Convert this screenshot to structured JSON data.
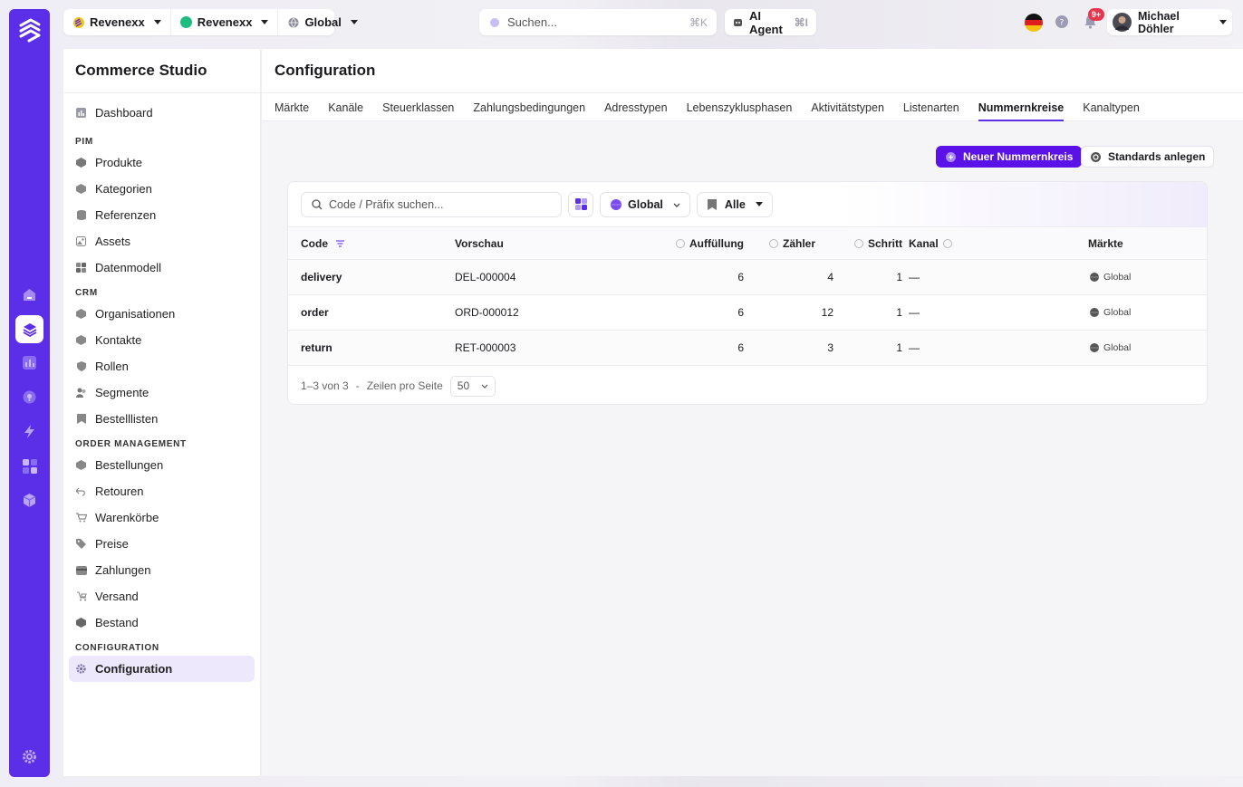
{
  "topbar": {
    "tenant1": "Revenexx",
    "tenant2": "Revenexx",
    "scope": "Global",
    "search_placeholder": "Suchen...",
    "search_shortcut": "⌘K",
    "agent_label": "AI Agent",
    "agent_shortcut": "⌘I",
    "notification_badge": "9+",
    "user_name": "Michael Döhler"
  },
  "sidebar": {
    "title": "Commerce Studio",
    "dashboard": "Dashboard",
    "sections": [
      {
        "label": "PIM",
        "items": [
          "Produkte",
          "Kategorien",
          "Referenzen",
          "Assets",
          "Datenmodell"
        ]
      },
      {
        "label": "CRM",
        "items": [
          "Organisationen",
          "Kontakte",
          "Rollen",
          "Segmente",
          "Bestelllisten"
        ]
      },
      {
        "label": "ORDER MANAGEMENT",
        "items": [
          "Bestellungen",
          "Retouren",
          "Warenkörbe",
          "Preise",
          "Zahlungen",
          "Versand",
          "Bestand"
        ]
      },
      {
        "label": "CONFIGURATION",
        "items": [
          "Configuration"
        ]
      }
    ]
  },
  "main": {
    "title": "Configuration",
    "tabs": [
      "Märkte",
      "Kanäle",
      "Steuerklassen",
      "Zahlungsbedingungen",
      "Adresstypen",
      "Lebenszyklusphasen",
      "Aktivitätstypen",
      "Listenarten",
      "Nummernkreise",
      "Kanaltypen"
    ],
    "active_tab": "Nummernkreise",
    "new_button": "Neuer Nummernkreis",
    "defaults_button": "Standards anlegen",
    "filter": {
      "search_placeholder": "Code / Präfix suchen...",
      "scope": "Global",
      "status": "Alle"
    },
    "columns": {
      "code": "Code",
      "preview": "Vorschau",
      "padding": "Auffüllung",
      "counter": "Zähler",
      "step": "Schritt",
      "channel": "Kanal",
      "markets": "Märkte"
    },
    "rows": [
      {
        "code": "delivery",
        "preview": "DEL-000004",
        "padding": "6",
        "counter": "4",
        "step": "1",
        "channel": "—",
        "market": "Global"
      },
      {
        "code": "order",
        "preview": "ORD-000012",
        "padding": "6",
        "counter": "12",
        "step": "1",
        "channel": "—",
        "market": "Global"
      },
      {
        "code": "return",
        "preview": "RET-000003",
        "padding": "6",
        "counter": "3",
        "step": "1",
        "channel": "—",
        "market": "Global"
      }
    ],
    "pagination": {
      "range": "1–3 von 3",
      "separator": "-",
      "rows_per_page_label": "Zeilen pro Seite",
      "rows_per_page": "50"
    }
  },
  "colors": {
    "accent": "#5b2ee8",
    "primary_button": "#5b12e8",
    "badge": "#e8364f"
  }
}
